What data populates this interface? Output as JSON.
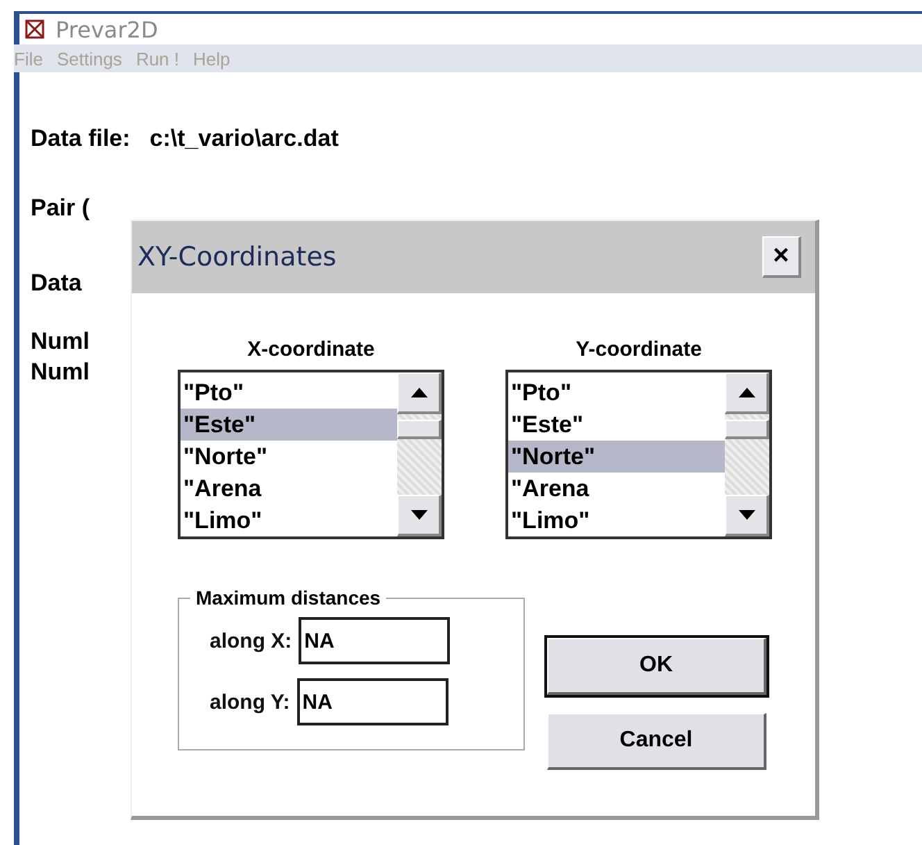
{
  "window": {
    "title": "Prevar2D"
  },
  "menu": [
    "File",
    "Settings",
    "Run !",
    "Help"
  ],
  "background": {
    "data_file_label": "Data file:",
    "data_file_value": "c:\\t_vario\\arc.dat",
    "lines": [
      "Pair (",
      "Data",
      "Numl",
      "Numl"
    ]
  },
  "dialog": {
    "title": "XY-Coordinates",
    "close": "×",
    "lists": [
      {
        "label": "X-coordinate",
        "items": [
          {
            "text": "\"Pto\"",
            "selected": false
          },
          {
            "text": "\"Este\"",
            "selected": true
          },
          {
            "text": "\"Norte\"",
            "selected": false
          },
          {
            "text": "\"Arena",
            "selected": false
          },
          {
            "text": "\"Limo\"",
            "selected": false
          }
        ]
      },
      {
        "label": "Y-coordinate",
        "items": [
          {
            "text": "\"Pto\"",
            "selected": false
          },
          {
            "text": "\"Este\"",
            "selected": false
          },
          {
            "text": "\"Norte\"",
            "selected": true
          },
          {
            "text": "\"Arena",
            "selected": false
          },
          {
            "text": "\"Limo\"",
            "selected": false
          }
        ]
      }
    ],
    "group": {
      "title": "Maximum distances",
      "fields": [
        {
          "label": "along X:",
          "value": "NA"
        },
        {
          "label": "along Y:",
          "value": "NA"
        }
      ]
    },
    "buttons": [
      {
        "label": "OK",
        "default": true
      },
      {
        "label": "Cancel",
        "default": false
      }
    ]
  }
}
